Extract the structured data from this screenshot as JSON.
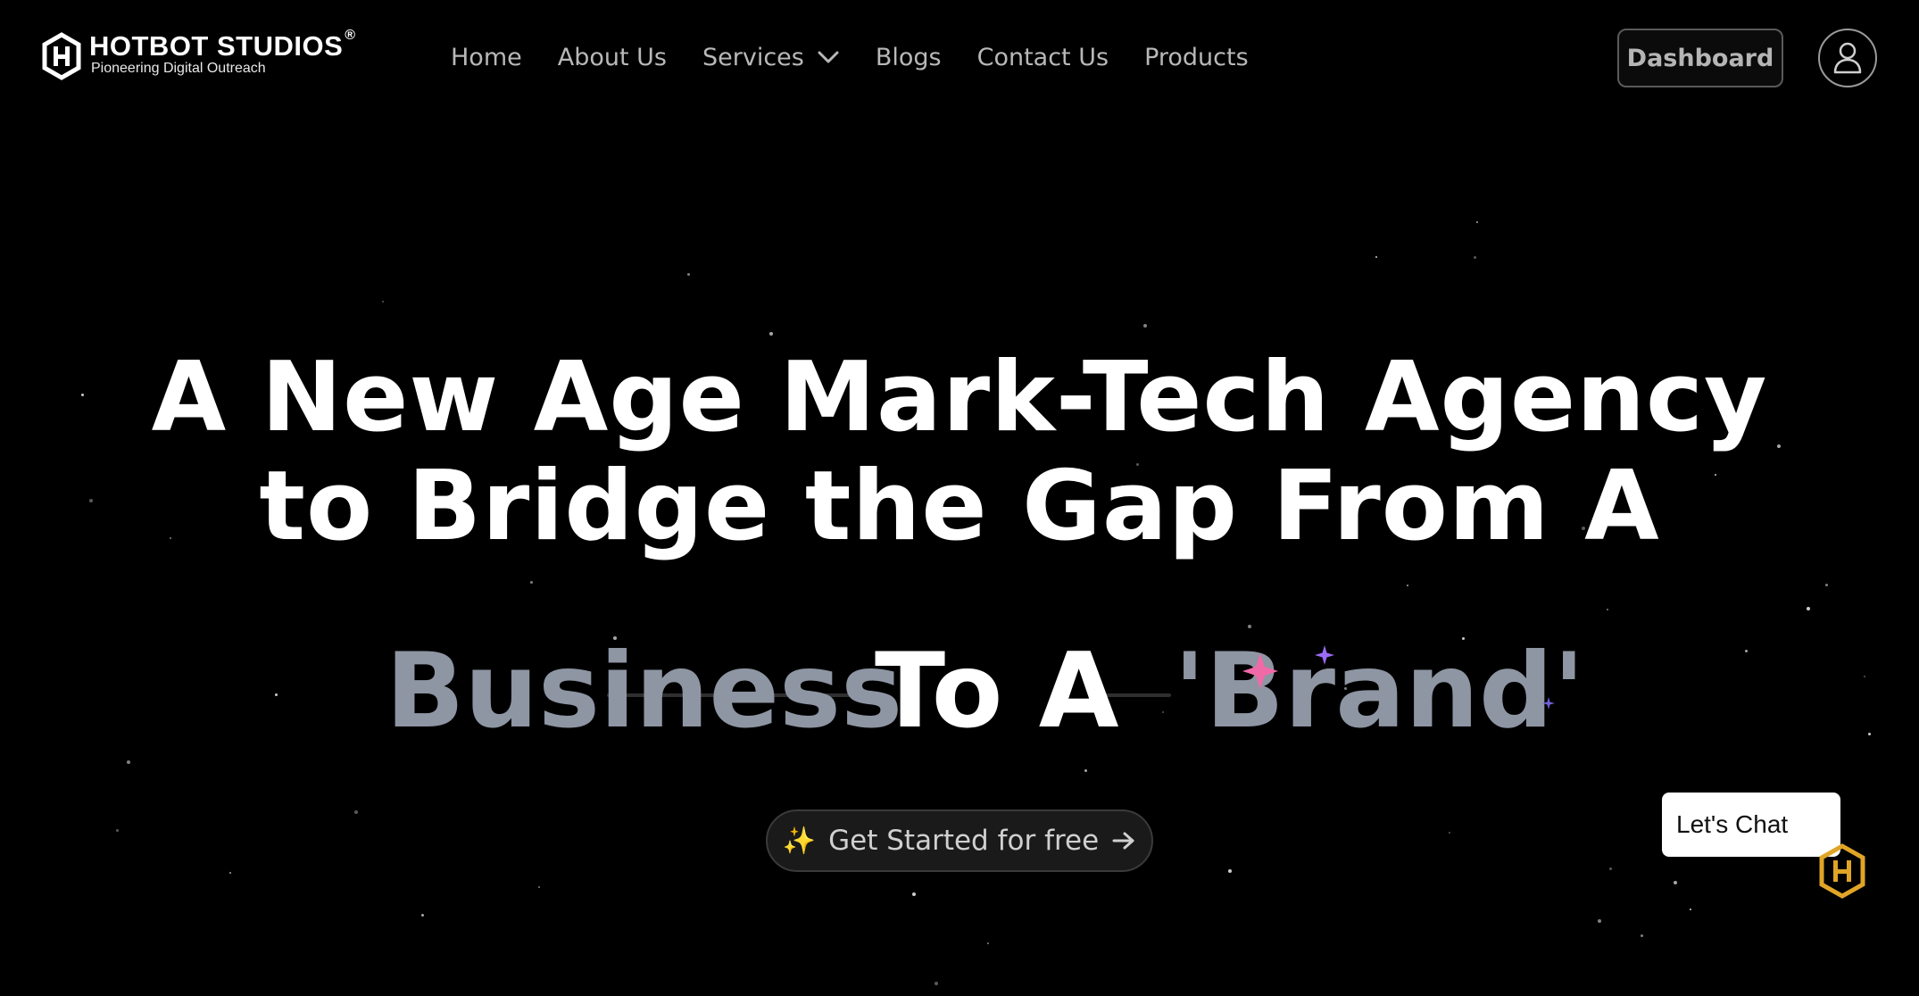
{
  "brand": {
    "name": "HOTBOT STUDIOS",
    "registered_mark": "®",
    "tagline": "Pioneering Digital Outreach"
  },
  "nav": {
    "items": [
      {
        "label": "Home"
      },
      {
        "label": "About Us"
      },
      {
        "label": "Services",
        "has_dropdown": true
      },
      {
        "label": "Blogs"
      },
      {
        "label": "Contact Us"
      },
      {
        "label": "Products"
      }
    ],
    "dashboard_label": "Dashboard"
  },
  "hero": {
    "line1": "A New Age Mark-Tech Agency",
    "line2": "to Bridge the Gap From A",
    "flow": {
      "from": "Business",
      "middle": "To A",
      "to": "'Brand'"
    },
    "cta_label": "Get Started for free",
    "cta_icon": "sparkles-icon"
  },
  "chat": {
    "label": "Let's Chat"
  },
  "colors": {
    "background": "#000000",
    "nav_text": "#b8b8b8",
    "muted_word": "#8e95a3",
    "logo_gold": "#e0a526",
    "sparkle_pink": "#f06aa8",
    "sparkle_purple": "#9b6cf5"
  }
}
